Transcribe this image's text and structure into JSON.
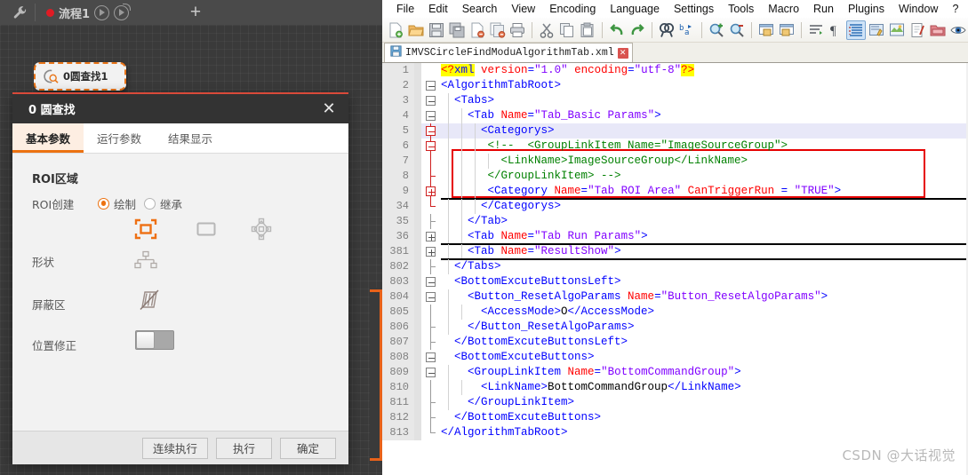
{
  "left_app": {
    "toolbar": {
      "wrench_icon": "wrench-icon",
      "flow_tab_label": "流程1",
      "run_icon": "play-circle-icon",
      "loop_icon": "play-loop-circle-icon",
      "add_tab_label": "+"
    },
    "node": {
      "label": "0圆查找1",
      "icon": "circle-find-magnifier-icon"
    }
  },
  "dialog": {
    "title": "0 圆查找",
    "close_label": "✕",
    "tabs": [
      {
        "label": "基本参数",
        "active": true
      },
      {
        "label": "运行参数",
        "active": false
      },
      {
        "label": "结果显示",
        "active": false
      }
    ],
    "section_title": "ROI区域",
    "fields": {
      "roi_create_label": "ROI创建",
      "roi_create_options": [
        {
          "label": "绘制",
          "selected": true
        },
        {
          "label": "继承",
          "selected": false
        }
      ],
      "shape_label": "形状",
      "shape_icons": [
        "roi-rect-brackets-icon",
        "roi-rectangle-icon",
        "roi-polygon-nodes-icon",
        "roi-mask-tree-icon"
      ],
      "mask_label": "屏蔽区",
      "mask_icon": "mask-disabled-icon",
      "position_correction_label": "位置修正",
      "position_correction_on": false
    },
    "footer_buttons": [
      "连续执行",
      "执行",
      "确定"
    ]
  },
  "notepad": {
    "menu": [
      "File",
      "Edit",
      "Search",
      "View",
      "Encoding",
      "Language",
      "Settings",
      "Tools",
      "Macro",
      "Run",
      "Plugins",
      "Window",
      "?"
    ],
    "toolbar_icons": [
      "new-file-icon",
      "open-file-icon",
      "save-icon",
      "save-all-icon",
      "close-file-icon",
      "close-all-icon",
      "print-icon",
      "sep",
      "cut-icon",
      "copy-icon",
      "paste-icon",
      "sep",
      "undo-icon",
      "redo-icon",
      "sep",
      "find-icon",
      "replace-icon",
      "sep",
      "zoom-in-icon",
      "zoom-out-icon",
      "sep",
      "sync-vertical-scroll-icon",
      "sync-horizontal-scroll-icon",
      "sep",
      "word-wrap-icon",
      "show-all-chars-icon",
      "indent-guide-icon",
      "user-define-dialog-icon",
      "show-document-map-icon",
      "function-list-icon",
      "folder-as-workspace-icon",
      "monitoring-icon"
    ],
    "tab": {
      "filename": "IMVSCircleFindModuAlgorithmTab.xml",
      "save_icon": "save-disk-icon",
      "close_icon": "close-tab-icon"
    },
    "watermark": "CSDN @大话视觉",
    "code_lines": [
      {
        "num": "1",
        "indent": 0,
        "fold": "none",
        "highlight": false,
        "tokens": [
          {
            "t": "pi",
            "v": "<?"
          },
          {
            "t": "pit",
            "v": "xml"
          },
          {
            "t": "plain",
            "v": " "
          },
          {
            "t": "attr",
            "v": "version"
          },
          {
            "t": "plain",
            "v": "="
          },
          {
            "t": "val",
            "v": "\"1.0\""
          },
          {
            "t": "plain",
            "v": " "
          },
          {
            "t": "attr",
            "v": "encoding"
          },
          {
            "t": "plain",
            "v": "="
          },
          {
            "t": "val",
            "v": "\"utf-8\""
          },
          {
            "t": "pi",
            "v": "?>"
          }
        ]
      },
      {
        "num": "2",
        "indent": 0,
        "fold": "minus",
        "highlight": false,
        "tokens": [
          {
            "t": "tag",
            "v": "<AlgorithmTabRoot>"
          }
        ]
      },
      {
        "num": "3",
        "indent": 1,
        "fold": "minus",
        "highlight": false,
        "tokens": [
          {
            "t": "tag",
            "v": "  <Tabs>"
          }
        ]
      },
      {
        "num": "4",
        "indent": 2,
        "fold": "minus",
        "highlight": false,
        "tokens": [
          {
            "t": "tag",
            "v": "    <Tab "
          },
          {
            "t": "attr",
            "v": "Name"
          },
          {
            "t": "plain",
            "v": "="
          },
          {
            "t": "val",
            "v": "\"Tab_Basic Params\""
          },
          {
            "t": "tag",
            "v": ">"
          }
        ]
      },
      {
        "num": "5",
        "indent": 3,
        "fold": "minus-red",
        "highlight": true,
        "tokens": [
          {
            "t": "tag",
            "v": "      <Categorys>"
          }
        ]
      },
      {
        "num": "6",
        "indent": 3,
        "fold": "minus-red",
        "highlight": false,
        "tokens": [
          {
            "t": "cmt",
            "v": "       <!--  <GroupLinkItem Name=\"ImageSourceGroup\">"
          }
        ]
      },
      {
        "num": "7",
        "indent": 4,
        "fold": "vline-red",
        "highlight": false,
        "tokens": [
          {
            "t": "cmt",
            "v": "         <LinkName>ImageSourceGroup</LinkName>"
          }
        ]
      },
      {
        "num": "8",
        "indent": 3,
        "fold": "tick-red",
        "highlight": false,
        "tokens": [
          {
            "t": "cmt",
            "v": "       </GroupLinkItem> -->"
          }
        ]
      },
      {
        "num": "9",
        "indent": 3,
        "fold": "plus-red",
        "highlight": false,
        "rule_below": true,
        "tokens": [
          {
            "t": "tag",
            "v": "       <Category "
          },
          {
            "t": "attr",
            "v": "Name"
          },
          {
            "t": "plain",
            "v": "="
          },
          {
            "t": "val",
            "v": "\"Tab ROI Area\""
          },
          {
            "t": "plain",
            "v": " "
          },
          {
            "t": "attr",
            "v": "CanTriggerRun"
          },
          {
            "t": "plain",
            "v": " = "
          },
          {
            "t": "val",
            "v": "\"TRUE\""
          },
          {
            "t": "tag",
            "v": ">"
          }
        ]
      },
      {
        "num": "34",
        "indent": 3,
        "fold": "endred",
        "highlight": false,
        "tokens": [
          {
            "t": "tag",
            "v": "      </Categorys>"
          }
        ]
      },
      {
        "num": "35",
        "indent": 2,
        "fold": "tick",
        "highlight": false,
        "tokens": [
          {
            "t": "tag",
            "v": "    </Tab>"
          }
        ]
      },
      {
        "num": "36",
        "indent": 2,
        "fold": "plus",
        "highlight": false,
        "rule_below": true,
        "tokens": [
          {
            "t": "tag",
            "v": "    <Tab "
          },
          {
            "t": "attr",
            "v": "Name"
          },
          {
            "t": "plain",
            "v": "="
          },
          {
            "t": "val",
            "v": "\"Tab Run Params\""
          },
          {
            "t": "tag",
            "v": ">"
          }
        ]
      },
      {
        "num": "381",
        "indent": 2,
        "fold": "plus",
        "highlight": false,
        "rule_below": true,
        "tokens": [
          {
            "t": "tag",
            "v": "    <Tab "
          },
          {
            "t": "attr",
            "v": "Name"
          },
          {
            "t": "plain",
            "v": "="
          },
          {
            "t": "val",
            "v": "\"ResultShow\""
          },
          {
            "t": "tag",
            "v": ">"
          }
        ]
      },
      {
        "num": "802",
        "indent": 1,
        "fold": "tick",
        "highlight": false,
        "tokens": [
          {
            "t": "tag",
            "v": "  </Tabs>"
          }
        ]
      },
      {
        "num": "803",
        "indent": 0,
        "fold": "minus",
        "highlight": false,
        "tokens": [
          {
            "t": "tag",
            "v": "  <BottomExcuteButtonsLeft>"
          }
        ]
      },
      {
        "num": "804",
        "indent": 1,
        "fold": "minus",
        "highlight": false,
        "tokens": [
          {
            "t": "tag",
            "v": "    <Button_ResetAlgoParams "
          },
          {
            "t": "attr",
            "v": "Name"
          },
          {
            "t": "plain",
            "v": "="
          },
          {
            "t": "val",
            "v": "\"Button_ResetAlgoParams\""
          },
          {
            "t": "tag",
            "v": ">"
          }
        ]
      },
      {
        "num": "805",
        "indent": 2,
        "fold": "vline",
        "highlight": false,
        "tokens": [
          {
            "t": "tag",
            "v": "      <AccessMode>"
          },
          {
            "t": "txt",
            "v": "O"
          },
          {
            "t": "tag",
            "v": "</AccessMode>"
          }
        ]
      },
      {
        "num": "806",
        "indent": 1,
        "fold": "tick",
        "highlight": false,
        "tokens": [
          {
            "t": "tag",
            "v": "    </Button_ResetAlgoParams>"
          }
        ]
      },
      {
        "num": "807",
        "indent": 0,
        "fold": "tick",
        "highlight": false,
        "tokens": [
          {
            "t": "tag",
            "v": "  </BottomExcuteButtonsLeft>"
          }
        ]
      },
      {
        "num": "808",
        "indent": 0,
        "fold": "minus",
        "highlight": false,
        "tokens": [
          {
            "t": "tag",
            "v": "  <BottomExcuteButtons>"
          }
        ]
      },
      {
        "num": "809",
        "indent": 1,
        "fold": "minus",
        "highlight": false,
        "tokens": [
          {
            "t": "tag",
            "v": "    <GroupLinkItem "
          },
          {
            "t": "attr",
            "v": "Name"
          },
          {
            "t": "plain",
            "v": "="
          },
          {
            "t": "val",
            "v": "\"BottomCommandGroup\""
          },
          {
            "t": "tag",
            "v": ">"
          }
        ]
      },
      {
        "num": "810",
        "indent": 2,
        "fold": "vline",
        "highlight": false,
        "tokens": [
          {
            "t": "tag",
            "v": "      <LinkName>"
          },
          {
            "t": "txt",
            "v": "BottomCommandGroup"
          },
          {
            "t": "tag",
            "v": "</LinkName>"
          }
        ]
      },
      {
        "num": "811",
        "indent": 1,
        "fold": "tick",
        "highlight": false,
        "tokens": [
          {
            "t": "tag",
            "v": "    </GroupLinkItem>"
          }
        ]
      },
      {
        "num": "812",
        "indent": 0,
        "fold": "tick",
        "highlight": false,
        "tokens": [
          {
            "t": "tag",
            "v": "  </BottomExcuteButtons>"
          }
        ]
      },
      {
        "num": "813",
        "indent": 0,
        "fold": "endbottom",
        "highlight": false,
        "tokens": [
          {
            "t": "tag",
            "v": "</AlgorithmTabRoot>"
          }
        ]
      }
    ]
  },
  "colors": {
    "accent_orange": "#ec7211",
    "dialog_titlebar": "#333333",
    "dialog_topline_red": "#d94a3a",
    "editor_highlight": "#e8e8f8",
    "red_rect": "#e60000",
    "npp_tab_top": "#e8961e"
  }
}
